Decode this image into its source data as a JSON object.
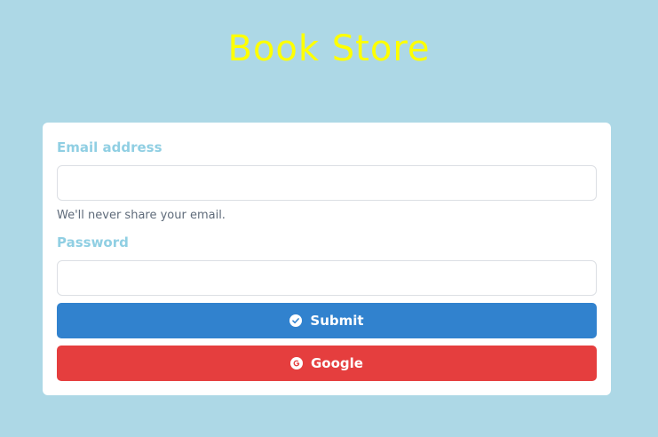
{
  "header": {
    "title": "Book Store"
  },
  "form": {
    "email": {
      "label": "Email address",
      "value": "",
      "placeholder": "",
      "help": "We'll never share your email."
    },
    "password": {
      "label": "Password",
      "value": "",
      "placeholder": ""
    },
    "submit": {
      "label": "Submit",
      "icon": "check-circle-icon"
    },
    "google": {
      "label": "Google",
      "icon": "google-icon"
    }
  },
  "colors": {
    "background": "#add8e6",
    "title": "#ffff00",
    "label": "#90cfe3",
    "submit": "#3182ce",
    "google": "#e53e3e"
  }
}
